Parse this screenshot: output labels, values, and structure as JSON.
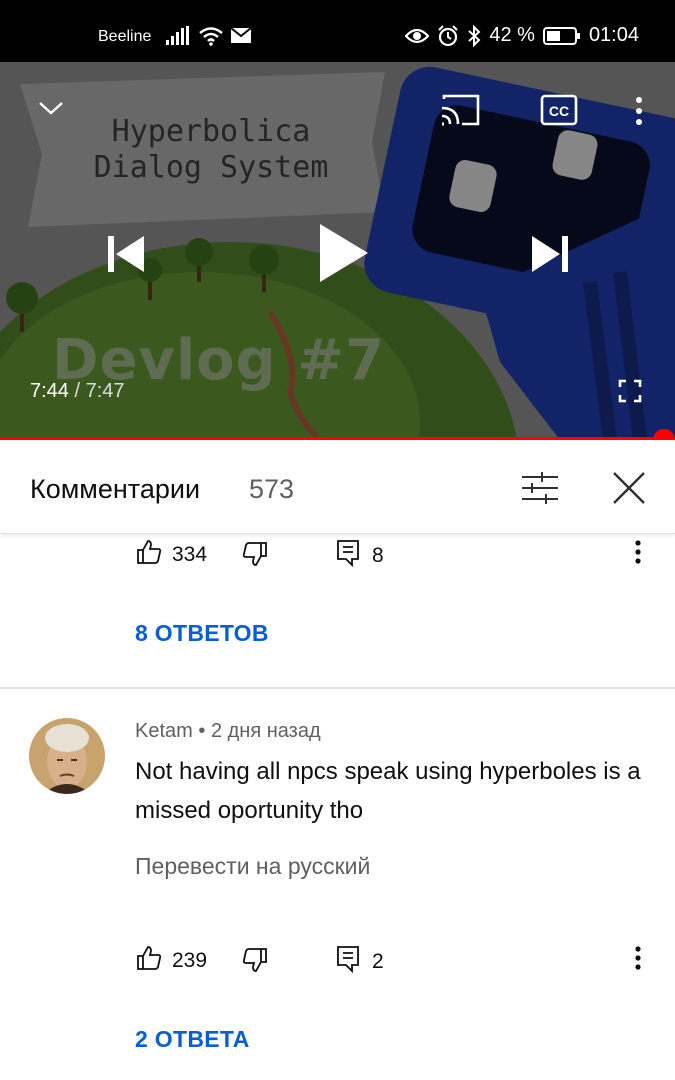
{
  "status_bar": {
    "carrier": "Beeline",
    "battery_percent": "42 %",
    "time": "01:04",
    "icons": [
      "signal-icon",
      "wifi-icon",
      "mail-icon",
      "eye-icon",
      "alarm-icon",
      "bluetooth-icon",
      "battery-icon"
    ]
  },
  "player": {
    "thumbnail_title_line1": "Hyperbolica",
    "thumbnail_title_line2": "Dialog System",
    "thumbnail_devlog": "Devlog #7",
    "current_time": "7:44",
    "separator": "/",
    "duration": "7:47",
    "progress_fraction": 0.994,
    "accent_color": "#ff0000"
  },
  "comments_panel": {
    "title": "Комментарии",
    "count": "573"
  },
  "comments": [
    {
      "likes": "334",
      "reply_count": "8",
      "replies_label": "8 ОТВЕТОВ"
    },
    {
      "author": "Ketam",
      "time_ago": "2 дня назад",
      "meta_separator": "•",
      "text": "Not having all npcs speak using hyperboles is a missed oportunity tho",
      "translate_label": "Перевести на русский",
      "likes": "239",
      "reply_count": "2",
      "replies_label": "2 ОТВЕТА"
    }
  ]
}
